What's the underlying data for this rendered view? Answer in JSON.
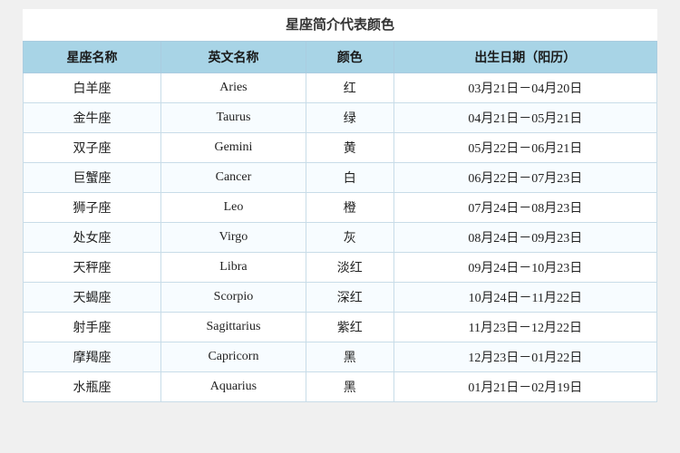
{
  "title": "星座简介代表颜色",
  "headers": [
    "星座名称",
    "英文名称",
    "颜色",
    "出生日期（阳历）"
  ],
  "rows": [
    {
      "chinese": "白羊座",
      "english": "Aries",
      "color": "红",
      "date": "03月21日－04月20日"
    },
    {
      "chinese": "金牛座",
      "english": "Taurus",
      "color": "绿",
      "date": "04月21日－05月21日"
    },
    {
      "chinese": "双子座",
      "english": "Gemini",
      "color": "黄",
      "date": "05月22日－06月21日"
    },
    {
      "chinese": "巨蟹座",
      "english": "Cancer",
      "color": "白",
      "date": "06月22日－07月23日"
    },
    {
      "chinese": "狮子座",
      "english": "Leo",
      "color": "橙",
      "date": "07月24日－08月23日"
    },
    {
      "chinese": "处女座",
      "english": "Virgo",
      "color": "灰",
      "date": "08月24日－09月23日"
    },
    {
      "chinese": "天秤座",
      "english": "Libra",
      "color": "淡红",
      "date": "09月24日－10月23日"
    },
    {
      "chinese": "天蝎座",
      "english": "Scorpio",
      "color": "深红",
      "date": "10月24日－11月22日"
    },
    {
      "chinese": "射手座",
      "english": "Sagittarius",
      "color": "紫红",
      "date": "11月23日－12月22日"
    },
    {
      "chinese": "摩羯座",
      "english": "Capricorn",
      "color": "黑",
      "date": "12月23日－01月22日"
    },
    {
      "chinese": "水瓶座",
      "english": "Aquarius",
      "color": "黑",
      "date": "01月21日－02月19日"
    }
  ]
}
